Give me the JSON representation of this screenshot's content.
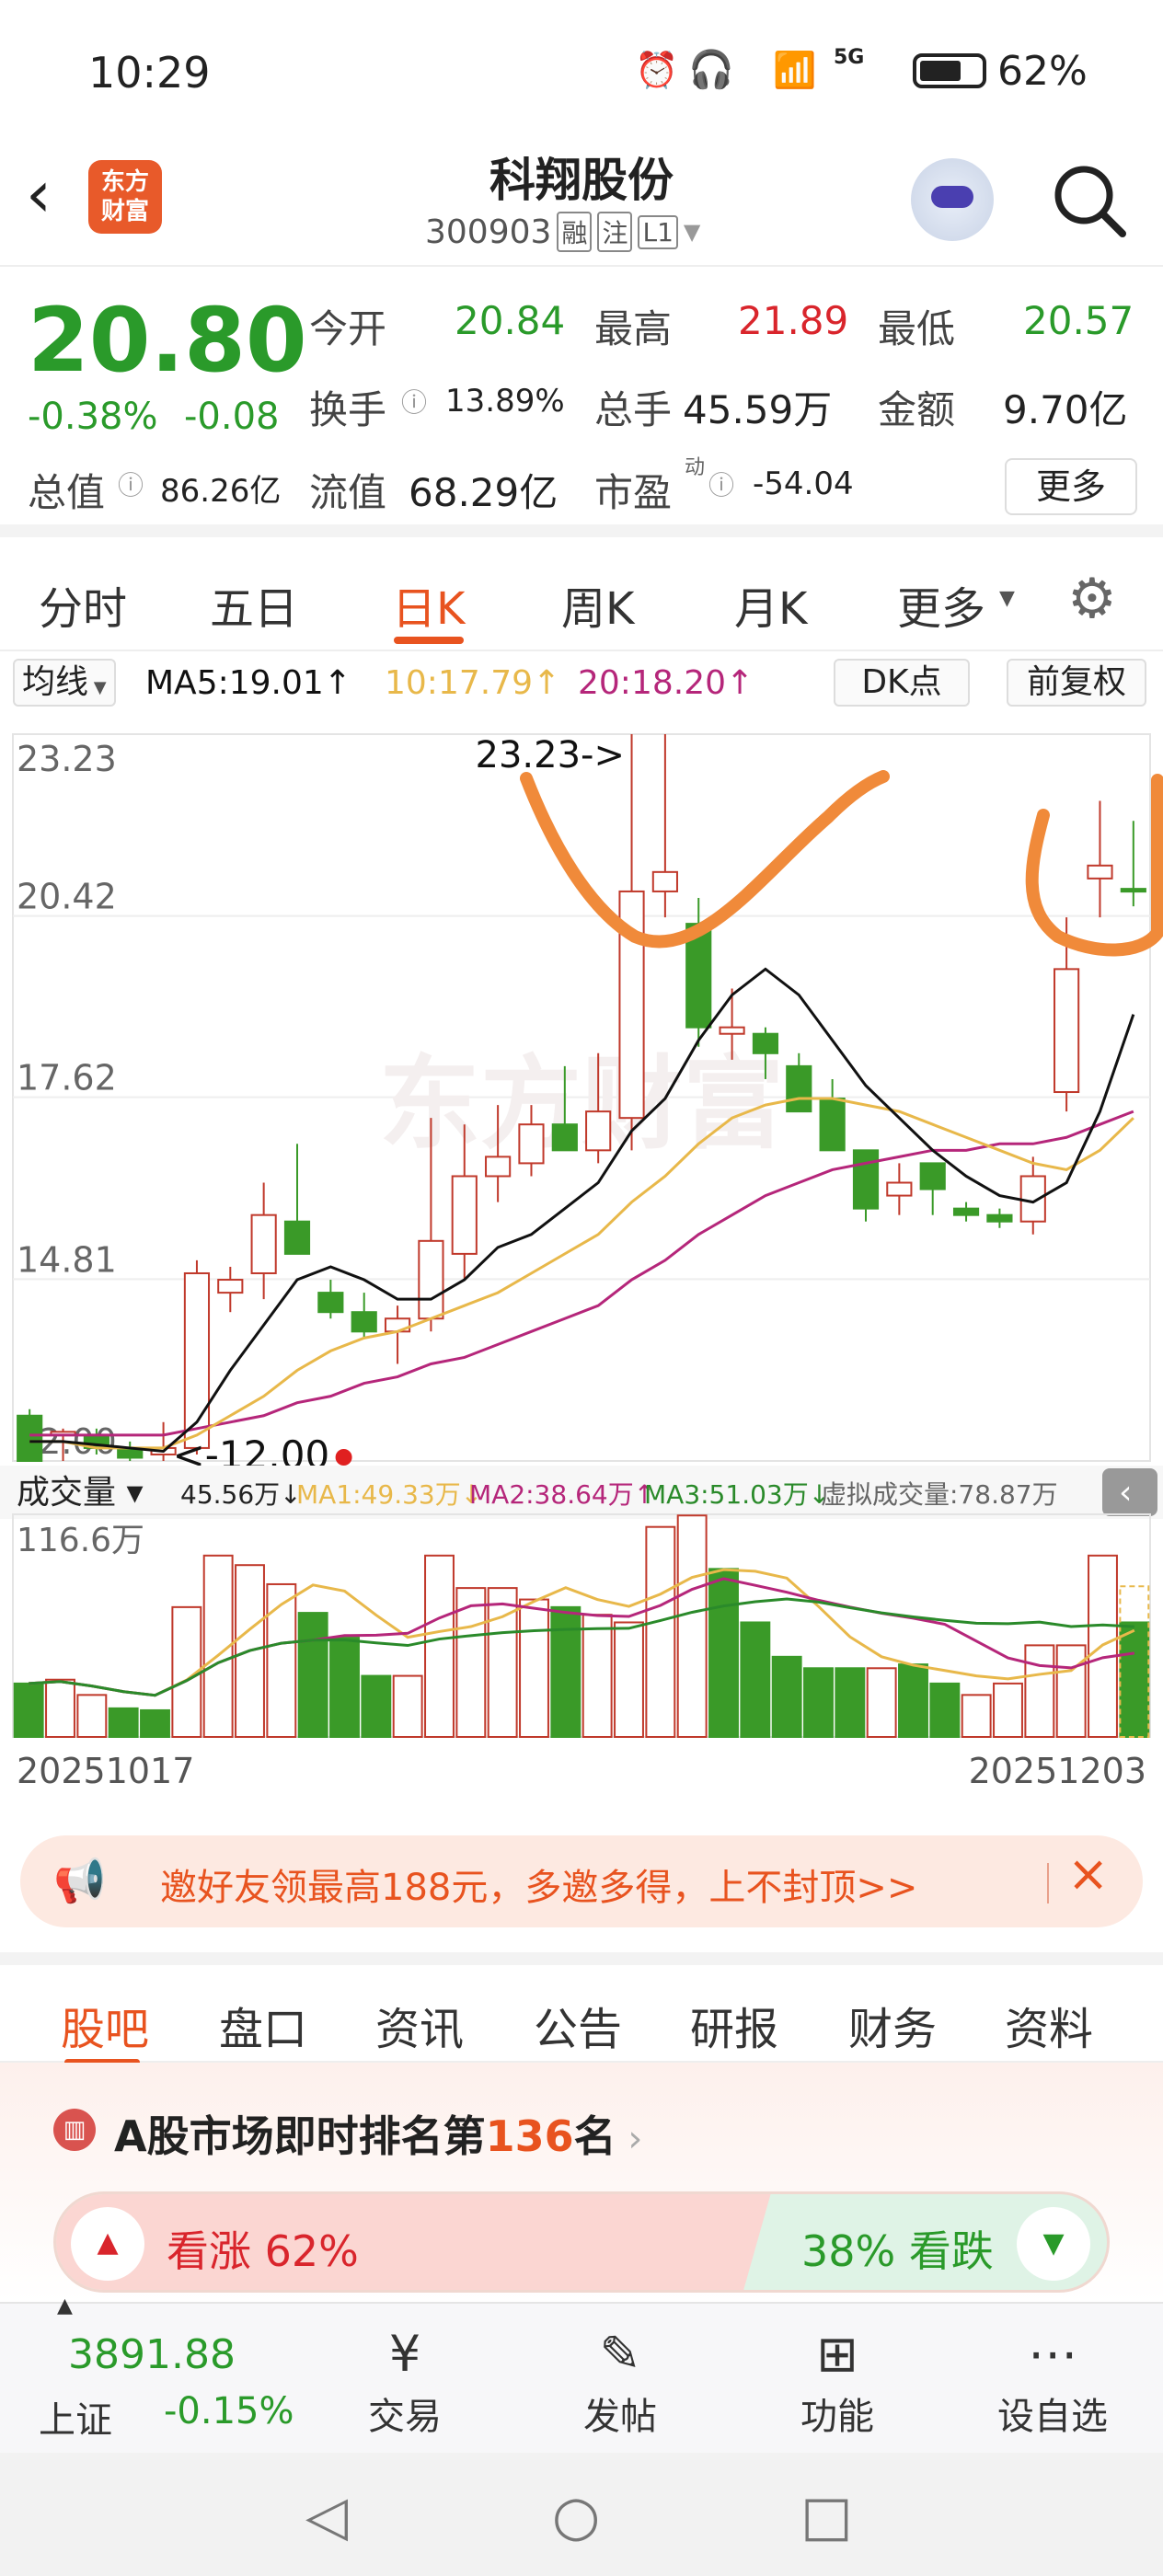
{
  "status_bar": {
    "time": "10:29",
    "battery": "62%",
    "network": "5G"
  },
  "header": {
    "title": "科翔股份",
    "code": "300903",
    "badges": [
      "融",
      "注",
      "L1"
    ],
    "logo_text": "东方\n财富"
  },
  "quote": {
    "price": "20.80",
    "change_pct": "-0.38%",
    "change": "-0.08",
    "open_label": "今开",
    "open": "20.84",
    "high_label": "最高",
    "high": "21.89",
    "low_label": "最低",
    "low": "20.57",
    "turnover_label": "换手",
    "turnover": "13.89%",
    "volume_label": "总手",
    "volume": "45.59万",
    "amount_label": "金额",
    "amount": "9.70亿",
    "mktcap_label": "总值",
    "mktcap": "86.26亿",
    "float_label": "流值",
    "float": "68.29亿",
    "pe_label": "市盈",
    "pe_sup": "动",
    "pe": "-54.04",
    "more_button": "更多"
  },
  "chart_tabs": [
    "分时",
    "五日",
    "日K",
    "周K",
    "月K",
    "更多"
  ],
  "active_chart_tab": 2,
  "kline": {
    "ma_selector": "均线",
    "ma5": "MA5:19.01",
    "ma10": "10:17.79",
    "ma20": "20:18.20",
    "dk_button": "DK点",
    "adjust_button": "前复权",
    "y_labels": [
      "23.23",
      "20.42",
      "17.62",
      "14.81",
      "12.00"
    ],
    "max_annotation": "23.23->",
    "min_annotation": "<-12.00",
    "watermark": "东方财富",
    "colors": {
      "up": "#c0392b",
      "down": "#3a9a28",
      "ma5": "#111111",
      "ma10": "#e8b84a",
      "ma20": "#b5267a",
      "annotation": "#f08a3a"
    }
  },
  "volume": {
    "selector": "成交量",
    "current": "45.56万",
    "ma1": "MA1:49.33万",
    "ma2": "MA2:38.64万",
    "ma3": "MA3:51.03万",
    "virtual": "虚拟成交量:78.87万",
    "max_label": "116.6万",
    "date_start": "20251017",
    "date_end": "20251203"
  },
  "chart_data": {
    "type": "candlestick",
    "y_range": [
      12.0,
      23.23
    ],
    "candles": [
      {
        "o": 12.7,
        "h": 12.8,
        "l": 12.0,
        "c": 12.0
      },
      {
        "o": 12.4,
        "h": 12.5,
        "l": 12.0,
        "c": 12.45
      },
      {
        "o": 12.4,
        "h": 12.5,
        "l": 12.1,
        "c": 12.2
      },
      {
        "o": 12.2,
        "h": 12.3,
        "l": 12.0,
        "c": 12.05
      },
      {
        "o": 12.1,
        "h": 12.6,
        "l": 12.0,
        "c": 12.2
      },
      {
        "o": 12.2,
        "h": 15.1,
        "l": 12.1,
        "c": 14.9
      },
      {
        "o": 14.6,
        "h": 15.0,
        "l": 14.3,
        "c": 14.8
      },
      {
        "o": 14.9,
        "h": 16.3,
        "l": 14.5,
        "c": 15.8
      },
      {
        "o": 15.7,
        "h": 16.9,
        "l": 15.5,
        "c": 15.2
      },
      {
        "o": 14.6,
        "h": 14.8,
        "l": 14.2,
        "c": 14.3
      },
      {
        "o": 14.3,
        "h": 14.6,
        "l": 13.9,
        "c": 14.0
      },
      {
        "o": 14.0,
        "h": 14.4,
        "l": 13.5,
        "c": 14.2
      },
      {
        "o": 14.2,
        "h": 17.3,
        "l": 14.0,
        "c": 15.4
      },
      {
        "o": 15.2,
        "h": 17.2,
        "l": 14.8,
        "c": 16.4
      },
      {
        "o": 16.4,
        "h": 17.5,
        "l": 16.0,
        "c": 16.7
      },
      {
        "o": 16.6,
        "h": 17.5,
        "l": 16.4,
        "c": 17.2
      },
      {
        "o": 17.2,
        "h": 18.1,
        "l": 16.9,
        "c": 16.8
      },
      {
        "o": 16.8,
        "h": 18.3,
        "l": 16.6,
        "c": 17.4
      },
      {
        "o": 17.3,
        "h": 23.23,
        "l": 16.8,
        "c": 20.8
      },
      {
        "o": 20.8,
        "h": 23.23,
        "l": 20.4,
        "c": 21.1
      },
      {
        "o": 20.3,
        "h": 20.7,
        "l": 18.4,
        "c": 18.7
      },
      {
        "o": 18.6,
        "h": 19.3,
        "l": 18.2,
        "c": 18.7
      },
      {
        "o": 18.6,
        "h": 18.7,
        "l": 17.9,
        "c": 18.3
      },
      {
        "o": 18.1,
        "h": 18.3,
        "l": 17.5,
        "c": 17.4
      },
      {
        "o": 17.6,
        "h": 17.9,
        "l": 16.9,
        "c": 16.8
      },
      {
        "o": 16.8,
        "h": 16.8,
        "l": 15.7,
        "c": 15.9
      },
      {
        "o": 16.1,
        "h": 16.6,
        "l": 15.8,
        "c": 16.3
      },
      {
        "o": 16.6,
        "h": 16.6,
        "l": 15.8,
        "c": 16.2
      },
      {
        "o": 15.9,
        "h": 16.0,
        "l": 15.7,
        "c": 15.8
      },
      {
        "o": 15.8,
        "h": 15.9,
        "l": 15.6,
        "c": 15.7
      },
      {
        "o": 15.7,
        "h": 16.7,
        "l": 15.5,
        "c": 16.4
      },
      {
        "o": 17.7,
        "h": 20.4,
        "l": 17.4,
        "c": 19.6
      },
      {
        "o": 21.0,
        "h": 22.2,
        "l": 20.4,
        "c": 21.2
      },
      {
        "o": 20.84,
        "h": 21.89,
        "l": 20.57,
        "c": 20.8
      }
    ],
    "ma5": [
      12.3,
      12.3,
      12.25,
      12.2,
      12.15,
      12.6,
      13.4,
      14.1,
      14.8,
      15.0,
      14.8,
      14.5,
      14.5,
      14.8,
      15.3,
      15.5,
      15.9,
      16.3,
      17.1,
      17.6,
      18.5,
      19.2,
      19.6,
      19.2,
      18.5,
      17.8,
      17.3,
      16.8,
      16.4,
      16.1,
      16.0,
      16.3,
      17.4,
      18.9
    ],
    "ma10": [
      12.3,
      12.3,
      12.2,
      12.2,
      12.2,
      12.4,
      12.7,
      13.0,
      13.4,
      13.7,
      13.9,
      14.0,
      14.2,
      14.4,
      14.6,
      14.9,
      15.2,
      15.5,
      16.0,
      16.4,
      16.9,
      17.3,
      17.5,
      17.6,
      17.6,
      17.5,
      17.4,
      17.2,
      17.0,
      16.8,
      16.6,
      16.5,
      16.8,
      17.3
    ],
    "ma20": [
      12.4,
      12.4,
      12.4,
      12.4,
      12.4,
      12.5,
      12.6,
      12.7,
      12.9,
      13.0,
      13.2,
      13.3,
      13.5,
      13.6,
      13.8,
      14.0,
      14.2,
      14.4,
      14.8,
      15.1,
      15.5,
      15.8,
      16.1,
      16.3,
      16.5,
      16.6,
      16.7,
      16.8,
      16.8,
      16.9,
      16.9,
      17.0,
      17.2,
      17.4
    ],
    "volume": [
      28,
      30,
      22,
      15,
      14,
      68,
      95,
      90,
      80,
      65,
      52,
      32,
      32,
      95,
      78,
      78,
      72,
      68,
      64,
      60,
      110,
      116,
      88,
      60,
      42,
      36,
      36,
      36,
      38,
      28,
      22,
      28,
      48,
      48,
      95,
      60
    ],
    "volume_colors": [
      "down",
      "up",
      "up",
      "down",
      "down",
      "up",
      "up",
      "up",
      "up",
      "down",
      "down",
      "down",
      "up",
      "up",
      "up",
      "up",
      "up",
      "down",
      "up",
      "up",
      "up",
      "up",
      "down",
      "down",
      "down",
      "down",
      "down",
      "up",
      "down",
      "down",
      "up",
      "up",
      "up",
      "up",
      "up",
      "down"
    ]
  },
  "banner": {
    "text": "邀好友领最高188元，多邀多得，上不封顶>>"
  },
  "sub_tabs": [
    "股吧",
    "盘口",
    "资讯",
    "公告",
    "研报",
    "财务",
    "资料"
  ],
  "rank": {
    "prefix": "A股市场即时排名第",
    "rank": "136",
    "suffix": "名",
    "bull_label": "看涨 62%",
    "bear_label": "38% 看跌",
    "bull_ratio": 0.62
  },
  "bottom_nav": {
    "index_value": "3891.88",
    "index_name": "上证",
    "index_change": "-0.15%",
    "items": [
      "交易",
      "发帖",
      "功能",
      "设自选"
    ]
  }
}
